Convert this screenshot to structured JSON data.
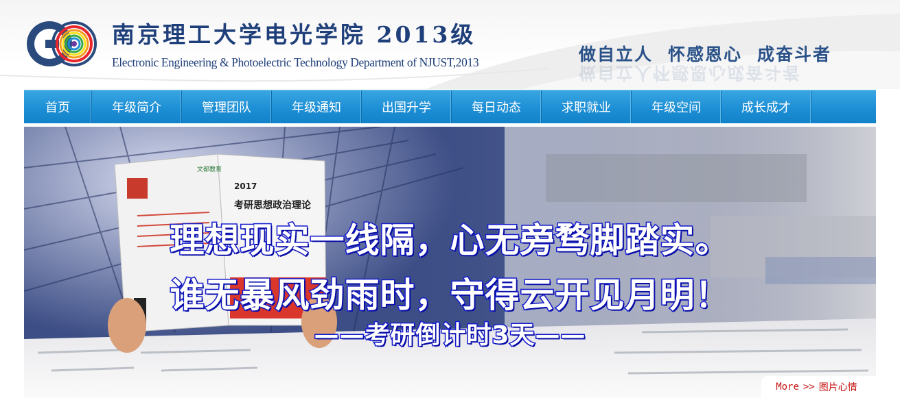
{
  "header": {
    "title_cn": "南京理工大学电光学院 2013级",
    "title_en": "Electronic Engineering & Photoelectric Technology Department of NJUST,2013",
    "logo_text": "EO",
    "motto": [
      "做自立人",
      "怀感恩心",
      "成奋斗者"
    ]
  },
  "nav": {
    "items": [
      {
        "label": "首页"
      },
      {
        "label": "年级简介"
      },
      {
        "label": "管理团队"
      },
      {
        "label": "年级通知"
      },
      {
        "label": "出国升学"
      },
      {
        "label": "每日动态"
      },
      {
        "label": "求职就业"
      },
      {
        "label": "年级空间"
      },
      {
        "label": "成长成才"
      }
    ]
  },
  "banner": {
    "book_year": "2017",
    "book_title": "考研思想政治理论",
    "book_brand": "文都教育",
    "line1": "理想现实一线隔，心无旁骛脚踏实。",
    "line2": "谁无暴风劲雨时，守得云开见月明！",
    "line3": "——考研倒计时3天——"
  },
  "more": {
    "more_label": "More",
    "arrow": ">>",
    "link_label": "图片心情"
  },
  "colors": {
    "nav_bg": "#1d8fd5",
    "title": "#1f3f7a",
    "slogan_stroke": "#1a22d9",
    "more_text": "#c81414"
  }
}
